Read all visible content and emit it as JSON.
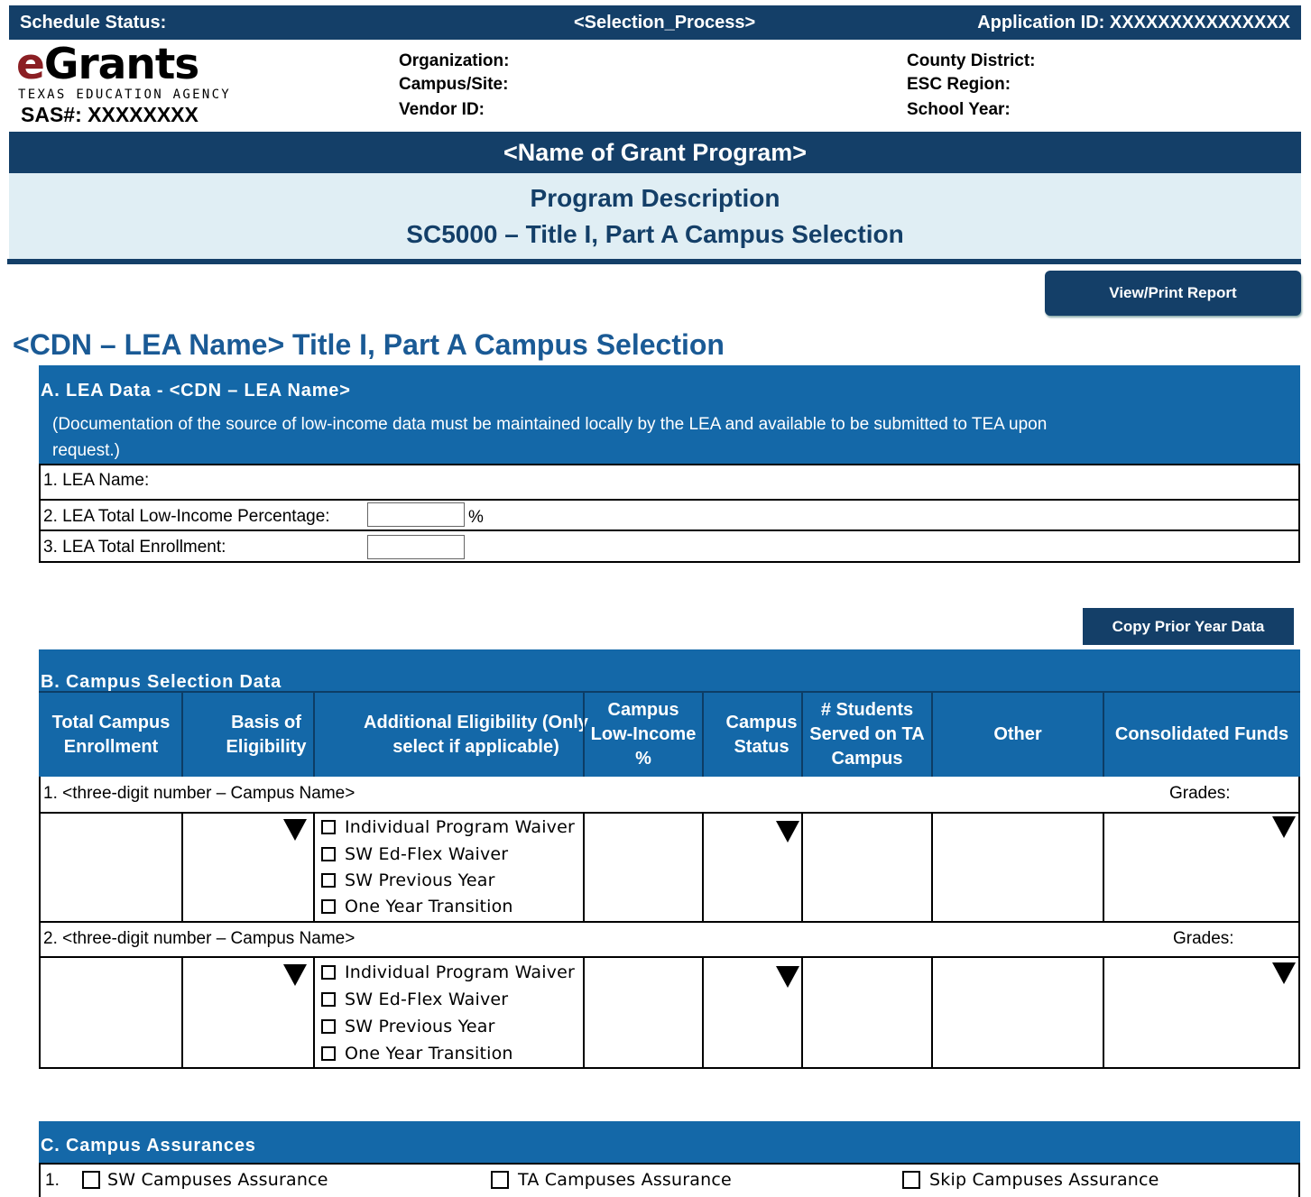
{
  "status_bar": {
    "schedule_status_label": "Schedule Status:",
    "selection_process": "<Selection_Process>",
    "application_id": "Application ID: XXXXXXXXXXXXXXX"
  },
  "logo": {
    "word_e": "e",
    "word_rest": "Grants",
    "agency": "TEXAS EDUCATION AGENCY",
    "sas": "SAS#: XXXXXXXX"
  },
  "header_info": {
    "left": [
      "Organization:",
      "Campus/Site:",
      "Vendor ID:"
    ],
    "right": [
      "County  District:",
      "ESC Region:",
      "School Year:"
    ]
  },
  "grant_program": "<Name of Grant Program>",
  "program_description": {
    "line1": "Program Description",
    "line2": "SC5000 – Title I, Part A Campus Selection"
  },
  "buttons": {
    "view_print": "View/Print Report",
    "copy_prior": "Copy Prior Year Data"
  },
  "page_heading": "<CDN – LEA Name> Title I, Part A Campus Selection",
  "section_a": {
    "title": "A.    LEA Data - <CDN – LEA Name>",
    "note_line1": "(Documentation of the source of low-income data must be maintained locally by the LEA and available to be submitted to TEA upon",
    "note_line2": "request.)",
    "rows": {
      "lea_name": "1. LEA Name:",
      "low_income": "2. LEA Total Low-Income Percentage:",
      "percent_sign": "%",
      "enrollment": "3. LEA Total Enrollment:"
    }
  },
  "section_b": {
    "title": "B.    Campus Selection Data",
    "columns": [
      "Total Campus Enrollment",
      "Basis of Eligibility",
      "Additional Eligibility (Only select if applicable)",
      "Campus Low-Income %",
      "Campus Status",
      "# Students Served on TA Campus",
      "Other",
      "Consolidated Funds"
    ],
    "campuses": [
      {
        "name": "1.  <three-digit number – Campus Name>",
        "grades_label": "Grades:",
        "options": [
          "Individual Program Waiver",
          "SW Ed-Flex Waiver",
          "SW Previous Year",
          "One Year Transition"
        ]
      },
      {
        "name": "2. <three-digit number – Campus Name>",
        "grades_label": "Grades:",
        "options": [
          "Individual Program Waiver",
          "SW Ed-Flex Waiver",
          "SW Previous Year",
          "One Year Transition"
        ]
      }
    ]
  },
  "section_c": {
    "title": "C.    Campus Assurances",
    "row_number": "1.",
    "assurances": [
      "SW Campuses Assurance",
      "TA Campuses Assurance",
      "Skip Campuses Assurance"
    ]
  },
  "colors": {
    "navy": "#143f68",
    "section_blue": "#1468a8",
    "light_band": "#e0eef4",
    "heading_blue": "#1a5a95",
    "logo_red": "#8b1f24"
  }
}
